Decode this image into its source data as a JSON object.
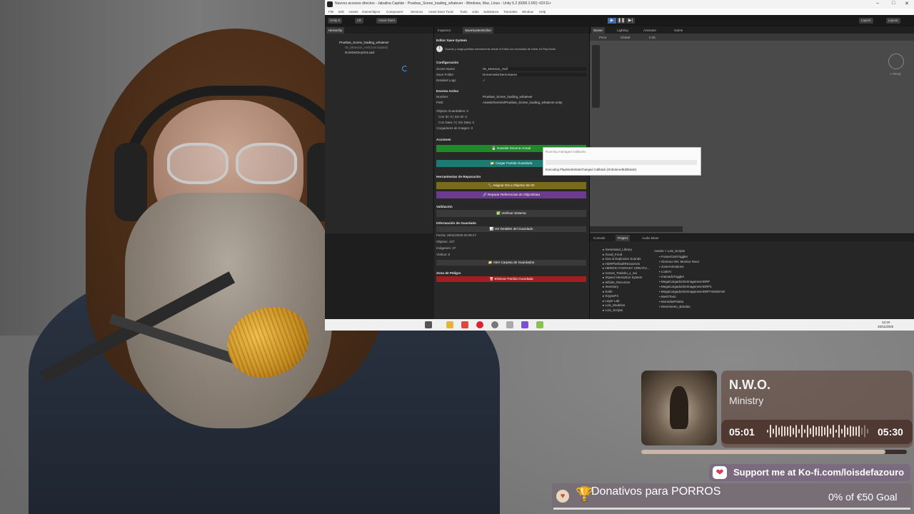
{
  "window": {
    "title": "Nuevos accesos directos - Jabalina Capitán - Pruebas_Scene_loading_whatever - Windows, Mac, Linux - Unity 6.2 (6000.2.6f2) <DX11>",
    "controls": [
      "–",
      "□",
      "✕"
    ]
  },
  "menubar": [
    "File",
    "Edit",
    "Assets",
    "GameObject",
    "Component",
    "Services",
    "Asset Store Tools",
    "Tools",
    "Jobs",
    "Substance",
    "Tutoriales",
    "Window",
    "Help"
  ],
  "toolbar": {
    "account": "Unity 6",
    "branch": "LR",
    "asset_store": "Asset Store",
    "layers": "Layers",
    "layout": "Layout"
  },
  "hierarchy": {
    "tab": "Hierarchy",
    "items": [
      "Pruebas_Scene_loading_whatever",
      "00_Mansion_Hall (not loaded)",
      "DontDestroyOnLoad"
    ]
  },
  "inspector": {
    "tabs": [
      "Inspector",
      "SaveSystemEditor"
    ],
    "header": "Editor Save System",
    "info": "Guarda y carga partidas directamente desde el Editor sin necesidad de entrar en Play Mode.",
    "config_title": "Configuración",
    "scene_name_label": "Scene Name",
    "scene_name_value": "00_Mansion_Hall",
    "save_folder_label": "Save Folder",
    "save_folder_value": "DreamValorDemoSaves",
    "detailed_logs_label": "Detailed Logs",
    "detailed_logs_value": "✓",
    "active_title": "Escena Activa",
    "name_label": "Nombre:",
    "name_value": "Pruebas_Scene_loading_whatever",
    "path_label": "Path:",
    "path_value": "Assets/Scenes/Pruebas_Scene_loading_whatever.unity",
    "objects_saved": "Objetos Guardables: 0",
    "with_id": "Con ID: 0 | Sin ID: 0",
    "with_data": "Con Data: 0 | Sin Data: 0",
    "image_loaders": "Cargadores de Imagen: 0",
    "actions_title": "Acciones",
    "save_scene_btn": "💾 Guardar Escena Actual",
    "load_game_btn": "📂 Cargar Partida Guardada",
    "repair_title": "Herramientas de Reparación",
    "assign_ids_btn": "🔧 Asignar IDs a Objetos Sin ID",
    "repair_refs_btn": "🔗 Reparar Referencias de ObjectData",
    "validation_title": "Validación",
    "verify_btn": "✅ Verificar Sistema",
    "saved_info_title": "Información de Guardado",
    "details_btn": "📊 Ver Detalles del Guardado",
    "date": "Fecha: 26/11/2025 02:09:47",
    "objects": "Objetos: 107",
    "images": "Imágenes: 37",
    "videos": "Vídeos: 8",
    "open_folder_btn": "📁 Abrir Carpeta de Guardados",
    "danger_title": "Zona de Peligro",
    "delete_btn": "🗑 Eliminar Partida Guardada"
  },
  "scene_view": {
    "tabs": [
      "Scene",
      "Lighting",
      "Animator",
      "Game"
    ],
    "persp": "< Persp",
    "pivot": "Pivot",
    "global": "Global",
    "snap": "0.25"
  },
  "progress_dialog": {
    "title": "Running managed callbacks",
    "detail": "Executing PlayModeStateChanged Callback (OnEnteredEditMode)"
  },
  "bottom_panel": {
    "tabs": [
      "Console",
      "Project",
      "Audio Mixer"
    ],
    "breadcrumb": "Assets > Lois_Scripts",
    "folders": [
      "Generated_Library",
      "Good_Food",
      "Gun & Explosion Sounds",
      "HDRPDefaultResources",
      "HEROIC FANTASY CREATU...",
      "Iconos_Todoslo_x_sai",
      "Impact Interaction System",
      "Infinite_Recursos",
      "Inventory",
      "Knife",
      "KryptoFX",
      "Layer Lab",
      "Lois_Modelos",
      "Lois_Scripts"
    ],
    "files": [
      "FrameCamToggler",
      "Glorious WC Monitor Raco",
      "JoseAnimations",
      "LookAt",
      "mamadoToggler",
      "MegaCargadorDeImagenesHDRP",
      "MegaCargadorDeImagenesHDRP1",
      "MegaCargadorDeImagenesHDRPYEMISIVE",
      "MeshToon",
      "MonedasPaleta",
      "Movimiento_Bandas"
    ]
  },
  "taskbar": {
    "time": "12:10",
    "date": "26/11/2025"
  },
  "now_playing": {
    "title": "N.W.O.",
    "artist": "Ministry",
    "elapsed": "05:01",
    "duration": "05:30",
    "progress": 0.92
  },
  "kofi": {
    "text": "Support me at Ko-fi.com/loisdefazouro"
  },
  "donation": {
    "title": "Donativos para PORROS",
    "goal": "0% of €50 Goal",
    "progress": 0.0
  },
  "colors": {
    "save_btn": "#1f8a2c",
    "load_btn": "#1c7a73",
    "assign_btn": "#7b6a1b",
    "repair_btn": "#6b3b8f",
    "delete_btn": "#a31e1e",
    "neutral_btn": "#3a3a3a"
  }
}
